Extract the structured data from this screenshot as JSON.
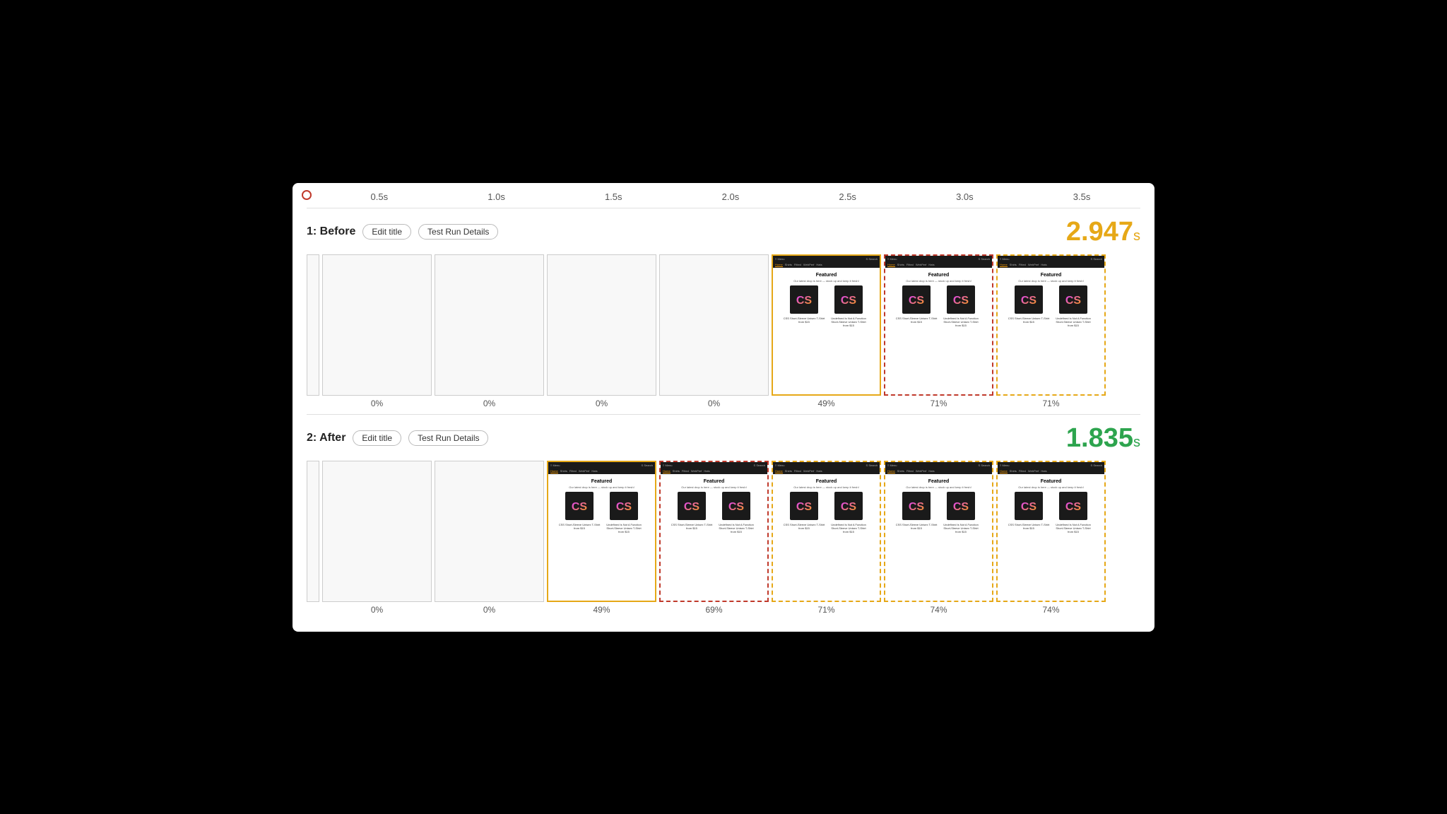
{
  "timeline": {
    "ticks": [
      "0.5s",
      "1.0s",
      "1.5s",
      "2.0s",
      "2.5s",
      "3.0s",
      "3.5s"
    ]
  },
  "before": {
    "section_label": "1: Before",
    "edit_title_label": "Edit title",
    "test_run_label": "Test Run Details",
    "score": "2.947",
    "score_unit": "s",
    "frames": [
      {
        "percent": "0%",
        "type": "empty"
      },
      {
        "percent": "0%",
        "type": "empty"
      },
      {
        "percent": "0%",
        "type": "empty"
      },
      {
        "percent": "0%",
        "type": "empty"
      },
      {
        "percent": "49%",
        "type": "browser",
        "border": "orange"
      },
      {
        "percent": "71%",
        "type": "browser",
        "border": "red-dash"
      },
      {
        "percent": "71%",
        "type": "browser",
        "border": "orange-dash"
      }
    ]
  },
  "after": {
    "section_label": "2: After",
    "edit_title_label": "Edit title",
    "test_run_label": "Test Run Details",
    "score": "1.835",
    "score_unit": "s",
    "frames": [
      {
        "percent": "0%",
        "type": "empty"
      },
      {
        "percent": "0%",
        "type": "empty"
      },
      {
        "percent": "49%",
        "type": "browser",
        "border": "orange"
      },
      {
        "percent": "69%",
        "type": "browser",
        "border": "red-dash"
      },
      {
        "percent": "71%",
        "type": "browser",
        "border": "orange-dash"
      },
      {
        "percent": "74%",
        "type": "browser",
        "border": "orange-dash"
      },
      {
        "percent": "74%",
        "type": "browser",
        "border": "orange-dash"
      }
    ]
  }
}
